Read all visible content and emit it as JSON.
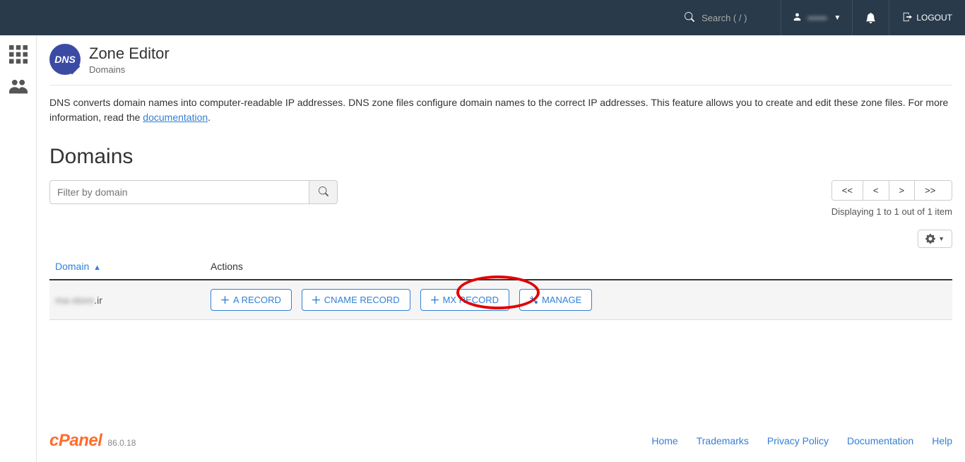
{
  "navbar": {
    "search_placeholder": "Search ( / )",
    "username": "••••••",
    "logout_label": "LOGOUT"
  },
  "page": {
    "title": "Zone Editor",
    "subtitle": "Domains",
    "description_pre": "DNS converts domain names into computer-readable IP addresses. DNS zone files configure domain names to the correct IP addresses. This feature allows you to create and edit these zone files. For more information, read the ",
    "description_link": "documentation",
    "description_post": "."
  },
  "section": {
    "title": "Domains",
    "filter_placeholder": "Filter by domain",
    "pagination": {
      "first": "<<",
      "prev": "<",
      "next": ">",
      "last": ">>",
      "info": "Displaying 1 to 1 out of 1 item"
    }
  },
  "table": {
    "headers": {
      "domain": "Domain",
      "actions": "Actions"
    },
    "rows": [
      {
        "domain_blurred": "ma-store",
        "domain_suffix": ".ir",
        "actions": {
          "a_record": "A RECORD",
          "cname_record": "CNAME RECORD",
          "mx_record": "MX RECORD",
          "manage": "MANAGE"
        }
      }
    ]
  },
  "footer": {
    "brand": "cPanel",
    "version": "86.0.18",
    "links": {
      "home": "Home",
      "trademarks": "Trademarks",
      "privacy": "Privacy Policy",
      "documentation": "Documentation",
      "help": "Help"
    }
  }
}
